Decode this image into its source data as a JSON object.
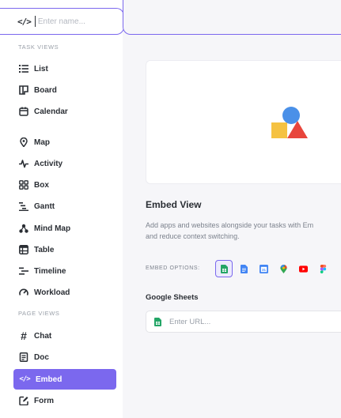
{
  "sidebar": {
    "name_placeholder": "Enter name...",
    "task_views_label": "TASK VIEWS",
    "page_views_label": "PAGE VIEWS",
    "task_views": [
      {
        "label": "List",
        "icon": "list-icon"
      },
      {
        "label": "Board",
        "icon": "board-icon"
      },
      {
        "label": "Calendar",
        "icon": "calendar-icon"
      },
      {
        "label": "Map",
        "icon": "map-pin-icon"
      },
      {
        "label": "Activity",
        "icon": "activity-icon"
      },
      {
        "label": "Box",
        "icon": "box-grid-icon"
      },
      {
        "label": "Gantt",
        "icon": "gantt-icon"
      },
      {
        "label": "Mind Map",
        "icon": "mind-map-icon"
      },
      {
        "label": "Table",
        "icon": "table-icon"
      },
      {
        "label": "Timeline",
        "icon": "timeline-icon"
      },
      {
        "label": "Workload",
        "icon": "workload-icon"
      }
    ],
    "page_views": [
      {
        "label": "Chat",
        "icon": "hashtag-icon"
      },
      {
        "label": "Doc",
        "icon": "doc-icon"
      },
      {
        "label": "Embed",
        "icon": "code-icon",
        "active": true
      },
      {
        "label": "Form",
        "icon": "form-icon"
      }
    ]
  },
  "main": {
    "title": "Embed View",
    "description_line1": "Add apps and websites alongside your tasks with Em",
    "description_line2": "and reduce context switching.",
    "embed_options_label": "EMBED OPTIONS:",
    "embed_options": [
      {
        "icon": "google-sheets-icon",
        "selected": true
      },
      {
        "icon": "google-docs-icon"
      },
      {
        "icon": "google-calendar-icon"
      },
      {
        "icon": "google-maps-icon"
      },
      {
        "icon": "youtube-icon"
      },
      {
        "icon": "figma-icon"
      }
    ],
    "selected_option_label": "Google Sheets",
    "url_placeholder": "Enter URL..."
  },
  "colors": {
    "accent": "#7b68ee",
    "shape_blue": "#4a90e8",
    "shape_yellow": "#f5c242",
    "shape_red": "#e8453c"
  }
}
